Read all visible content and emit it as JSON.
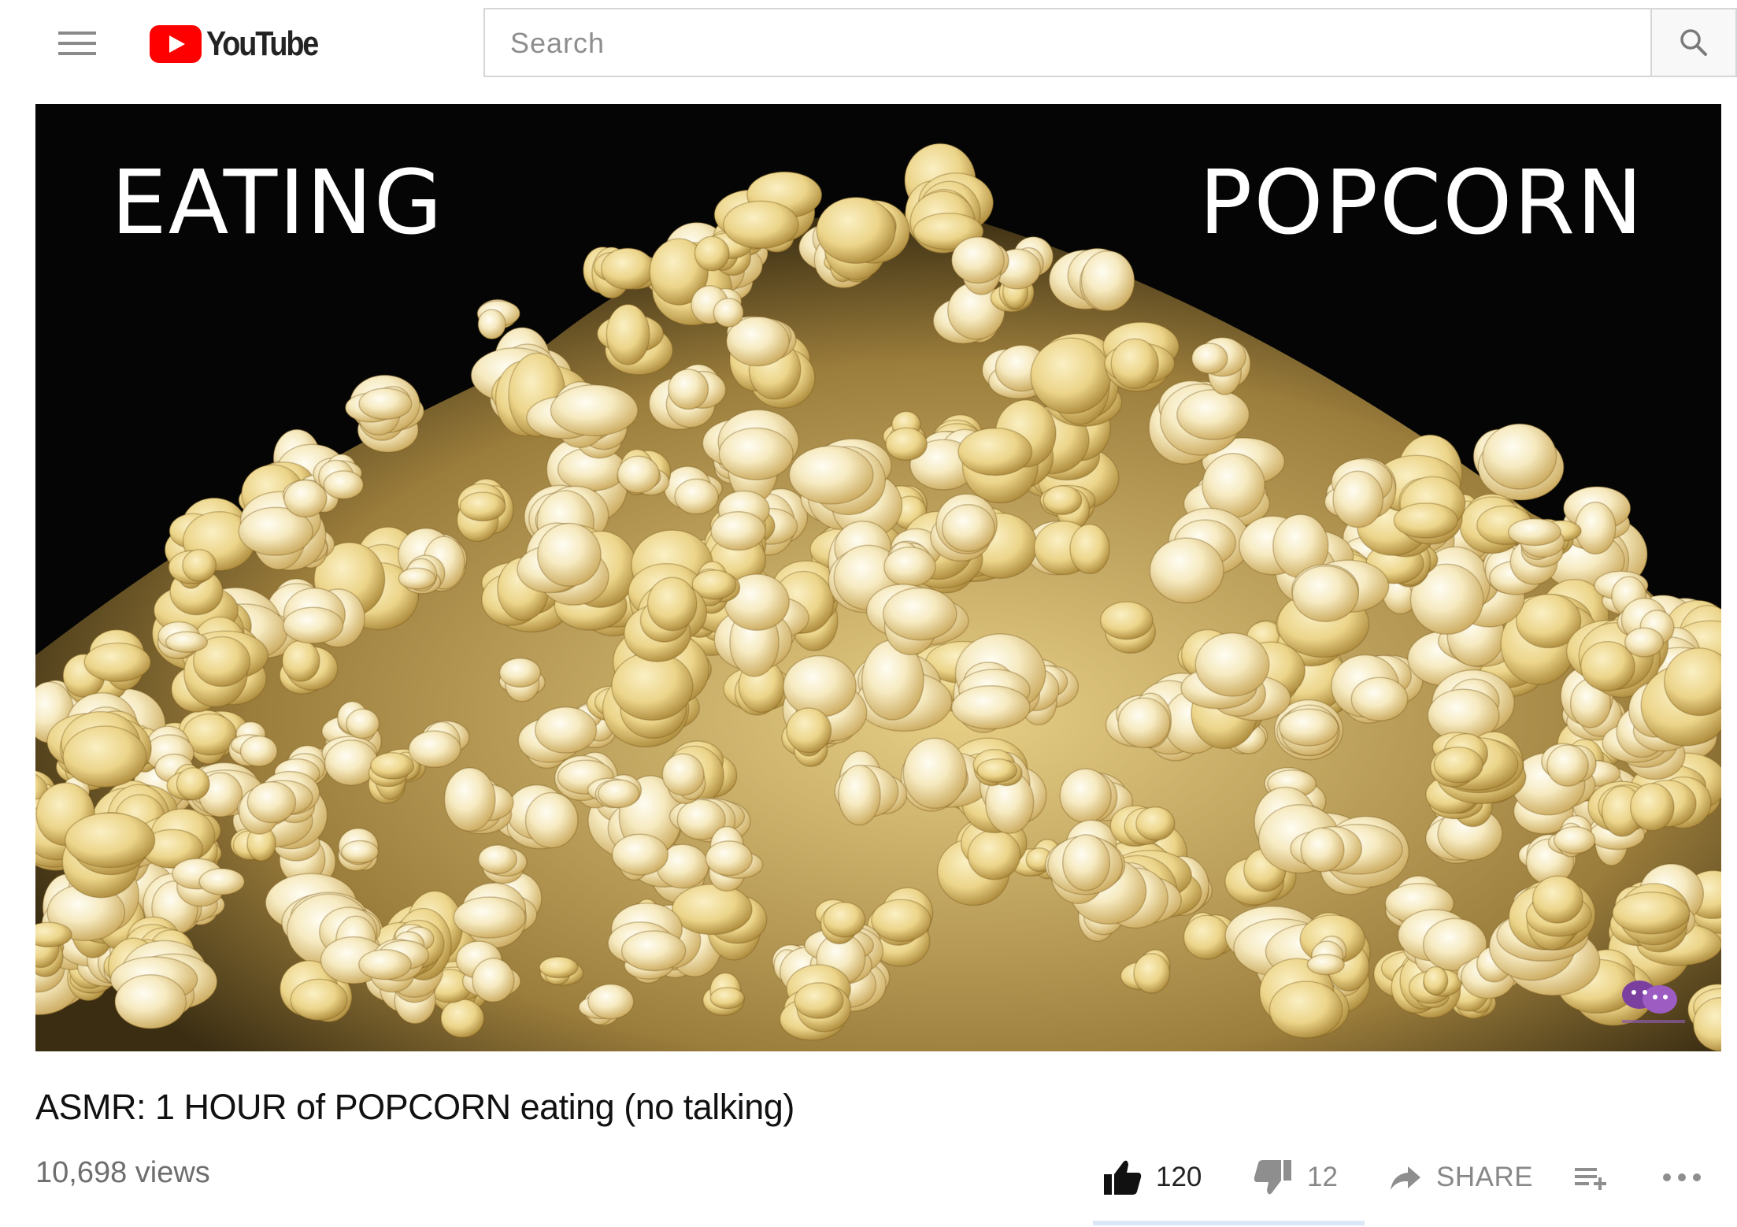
{
  "header": {
    "logo_text": "YouTube",
    "search_placeholder": "Search",
    "icons": {
      "menu": "hamburger-icon",
      "logo": "youtube-play-icon",
      "search": "search-icon"
    }
  },
  "video": {
    "overlay_left": "EATING",
    "overlay_right": "POPCORN",
    "title": "ASMR: 1 HOUR of POPCORN eating (no talking)",
    "views": "10,698 views"
  },
  "actions": {
    "like_count": "120",
    "dislike_count": "12",
    "share_label": "SHARE",
    "icons": {
      "like": "thumbs-up-icon",
      "dislike": "thumbs-down-icon",
      "share": "share-arrow-icon",
      "save": "add-to-playlist-icon",
      "more": "more-horizontal-icon"
    }
  },
  "colors": {
    "brand_red": "#ff0000",
    "text_primary": "#111111",
    "text_secondary": "#6e6e6e",
    "border": "#d6d6d6",
    "thumbnail_background": "#050505",
    "popcorn_yellow": "#f3df9c",
    "popcorn_white": "#fbf6e2"
  }
}
